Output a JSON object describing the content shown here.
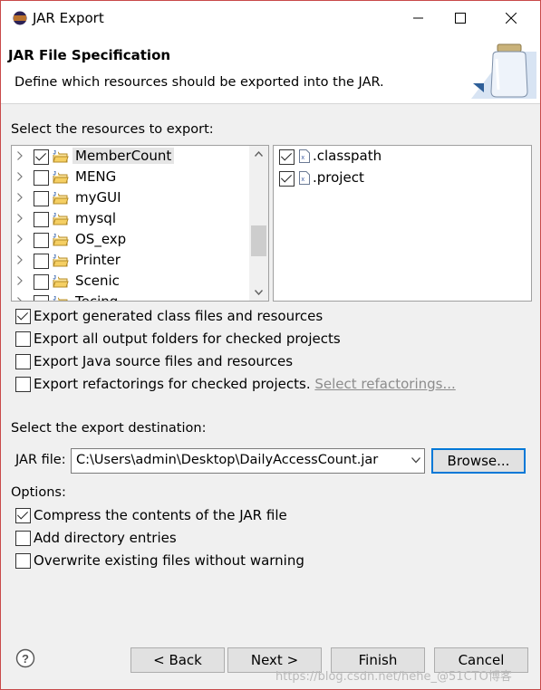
{
  "window": {
    "title": "JAR Export"
  },
  "banner": {
    "heading": "JAR File Specification",
    "description": "Define which resources should be exported into the JAR."
  },
  "resources": {
    "label": "Select the resources to export:",
    "projects": [
      {
        "name": "MemberCount",
        "checked": true,
        "selected": true
      },
      {
        "name": "MENG",
        "checked": false
      },
      {
        "name": "myGUI",
        "checked": false
      },
      {
        "name": "mysql",
        "checked": false
      },
      {
        "name": "OS_exp",
        "checked": false
      },
      {
        "name": "Printer",
        "checked": false
      },
      {
        "name": "Scenic",
        "checked": false
      },
      {
        "name": "Tecing",
        "checked": false
      }
    ],
    "files": [
      {
        "name": ".classpath",
        "checked": true
      },
      {
        "name": ".project",
        "checked": true
      }
    ]
  },
  "options_export": {
    "generated": {
      "label": "Export generated class files and resources",
      "checked": true
    },
    "output_folders": {
      "label": "Export all output folders for checked projects",
      "checked": false
    },
    "java_source": {
      "label": "Export Java source files and resources",
      "checked": false
    },
    "refactorings": {
      "label": "Export refactorings for checked projects.",
      "checked": false,
      "link": "Select refactorings..."
    }
  },
  "destination": {
    "label": "Select the export destination:",
    "jar_label": "JAR file:",
    "jar_path": "C:\\Users\\admin\\Desktop\\DailyAccessCount.jar",
    "browse": "Browse..."
  },
  "options": {
    "label": "Options:",
    "compress": {
      "label": "Compress the contents of the JAR file",
      "checked": true
    },
    "directory": {
      "label": "Add directory entries",
      "checked": false
    },
    "overwrite": {
      "label": "Overwrite existing files without warning",
      "checked": false
    }
  },
  "buttons": {
    "back": "< Back",
    "next": "Next >",
    "finish": "Finish",
    "cancel": "Cancel"
  },
  "watermark": "https://blog.csdn.net/hehe_@51CTO博客"
}
